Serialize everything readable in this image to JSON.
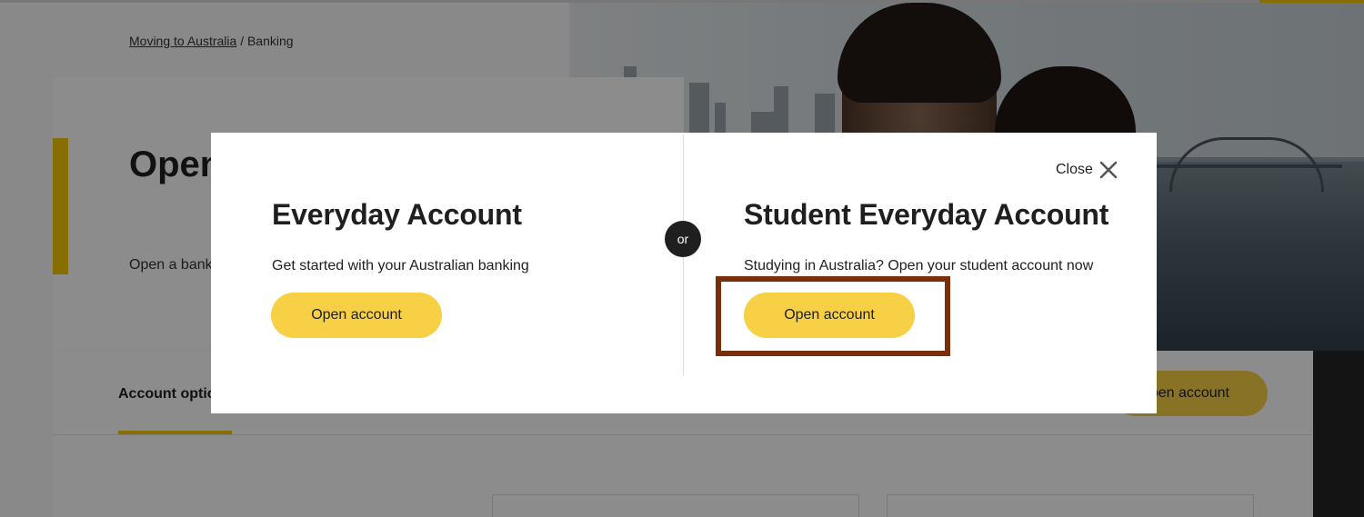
{
  "breadcrumb": {
    "link": "Moving to Australia",
    "separator": "/",
    "current": "Banking"
  },
  "hero": {
    "title": "Open an account",
    "subtitle": "Open a bank"
  },
  "tabs": {
    "active": "Account options"
  },
  "background_button": {
    "label": "Open account"
  },
  "modal": {
    "close_label": "Close",
    "close_icon": "close-icon",
    "or_label": "or",
    "left": {
      "title": "Everyday Account",
      "description": "Get started with your Australian banking",
      "button": "Open account"
    },
    "right": {
      "title": "Student Everyday Account",
      "description": "Studying in Australia? Open your student account now",
      "button": "Open account"
    }
  },
  "colors": {
    "accent": "#f5c800",
    "button": "#f7d046",
    "highlight_border": "#7a2e0c",
    "overlay": "rgba(0,0,0,0.45)"
  }
}
